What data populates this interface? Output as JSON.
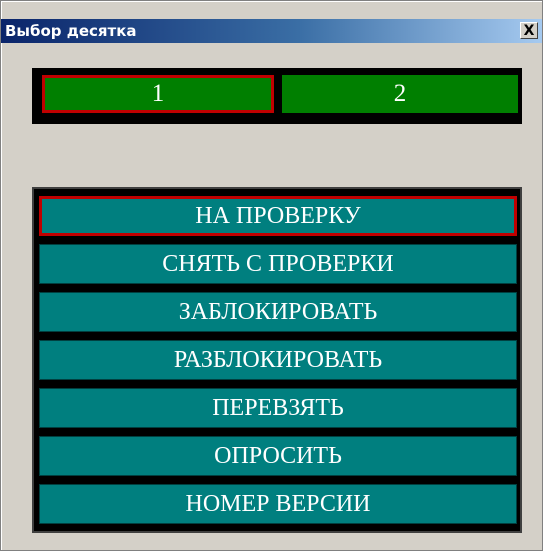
{
  "window": {
    "title": "Выбор десятка",
    "close_glyph": "X"
  },
  "groups": [
    {
      "label": "1",
      "selected": true
    },
    {
      "label": "2",
      "selected": false
    }
  ],
  "commands": [
    {
      "label": "НА ПРОВЕРКУ",
      "selected": true
    },
    {
      "label": "СНЯТЬ С ПРОВЕРКИ",
      "selected": false
    },
    {
      "label": "ЗАБЛОКИРОВАТЬ",
      "selected": false
    },
    {
      "label": "РАЗБЛОКИРОВАТЬ",
      "selected": false
    },
    {
      "label": "ПЕРЕВЗЯТЬ",
      "selected": false
    },
    {
      "label": "ОПРОСИТЬ",
      "selected": false
    },
    {
      "label": "НОМЕР ВЕРСИИ",
      "selected": false
    }
  ],
  "colors": {
    "group_button": "#007f00",
    "command_button": "#007f7f",
    "selection_border": "#c00000",
    "panel_background": "#000000",
    "window_background": "#d4d0c8"
  }
}
